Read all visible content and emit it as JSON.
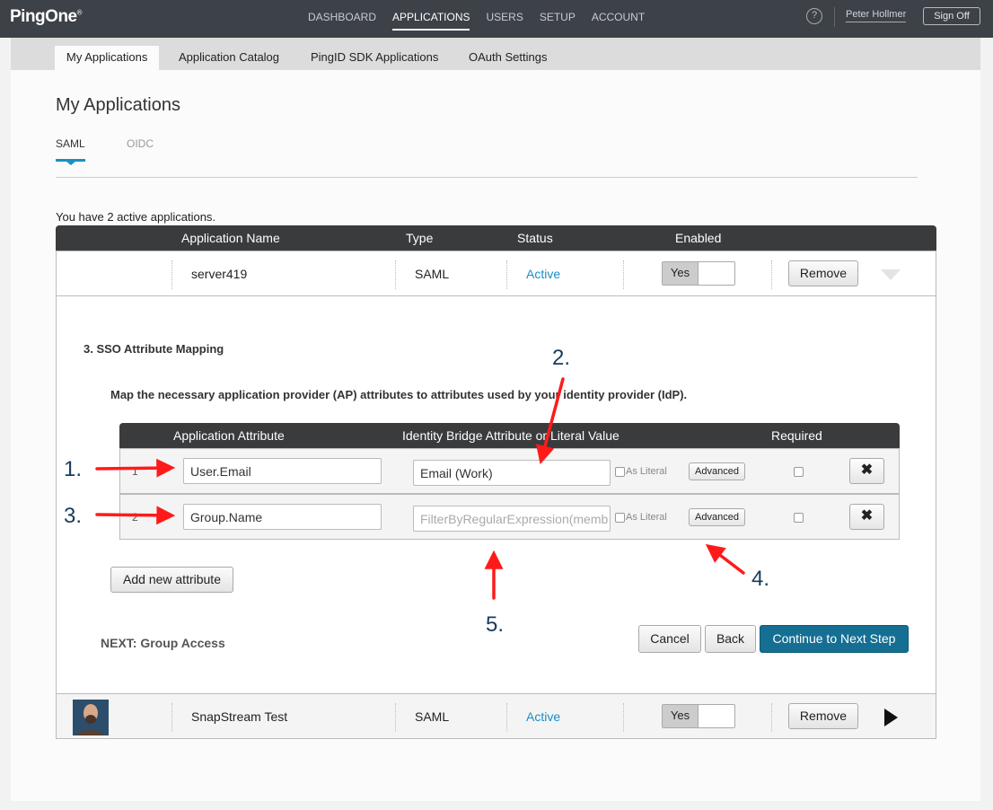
{
  "brand": {
    "name": "PingOne"
  },
  "topnav": {
    "items": [
      "DASHBOARD",
      "APPLICATIONS",
      "USERS",
      "SETUP",
      "ACCOUNT"
    ],
    "active": "APPLICATIONS",
    "help_glyph": "?",
    "user_name": "Peter Hollmer",
    "signoff_label": "Sign Off"
  },
  "subtabs": [
    "My Applications",
    "Application Catalog",
    "PingID SDK Applications",
    "OAuth Settings"
  ],
  "page": {
    "title": "My Applications",
    "protocol_tabs": [
      "SAML",
      "OIDC"
    ],
    "active_protocol": "SAML",
    "active_count_text": "You have 2 active applications."
  },
  "app_table": {
    "headers": {
      "name": "Application Name",
      "type": "Type",
      "status": "Status",
      "enabled": "Enabled"
    },
    "rows": [
      {
        "name": "server419",
        "type": "SAML",
        "status": "Active",
        "enabled": "Yes",
        "remove": "Remove",
        "expanded": true
      },
      {
        "name": "SnapStream Test",
        "type": "SAML",
        "status": "Active",
        "enabled": "Yes",
        "remove": "Remove",
        "expanded": false
      }
    ]
  },
  "mapping": {
    "step_title": "3. SSO Attribute Mapping",
    "description": "Map the necessary application provider (AP) attributes to attributes used by your identity provider (IdP).",
    "headers": {
      "app_attr": "Application Attribute",
      "idb_attr": "Identity Bridge Attribute or Literal Value",
      "required": "Required"
    },
    "rows": [
      {
        "num": "1",
        "app_attr": "User.Email",
        "idb_value": "Email (Work)",
        "is_placeholder": false,
        "as_literal": "As Literal",
        "advanced": "Advanced",
        "remove_glyph": "✖"
      },
      {
        "num": "2",
        "app_attr": "Group.Name",
        "idb_value": "FilterByRegularExpression(memb",
        "is_placeholder": true,
        "as_literal": "As Literal",
        "advanced": "Advanced",
        "remove_glyph": "✖"
      }
    ],
    "add_button": "Add new attribute",
    "next_label": "NEXT: Group Access",
    "buttons": {
      "cancel": "Cancel",
      "back": "Back",
      "continue": "Continue to Next Step"
    }
  },
  "annotations": [
    "1.",
    "2.",
    "3.",
    "4.",
    "5."
  ],
  "colors": {
    "topbar": "#3d4148",
    "link_active": "#1a8fc5",
    "primary_button": "#156f93",
    "annotation_arrow": "#ff1a1a"
  }
}
